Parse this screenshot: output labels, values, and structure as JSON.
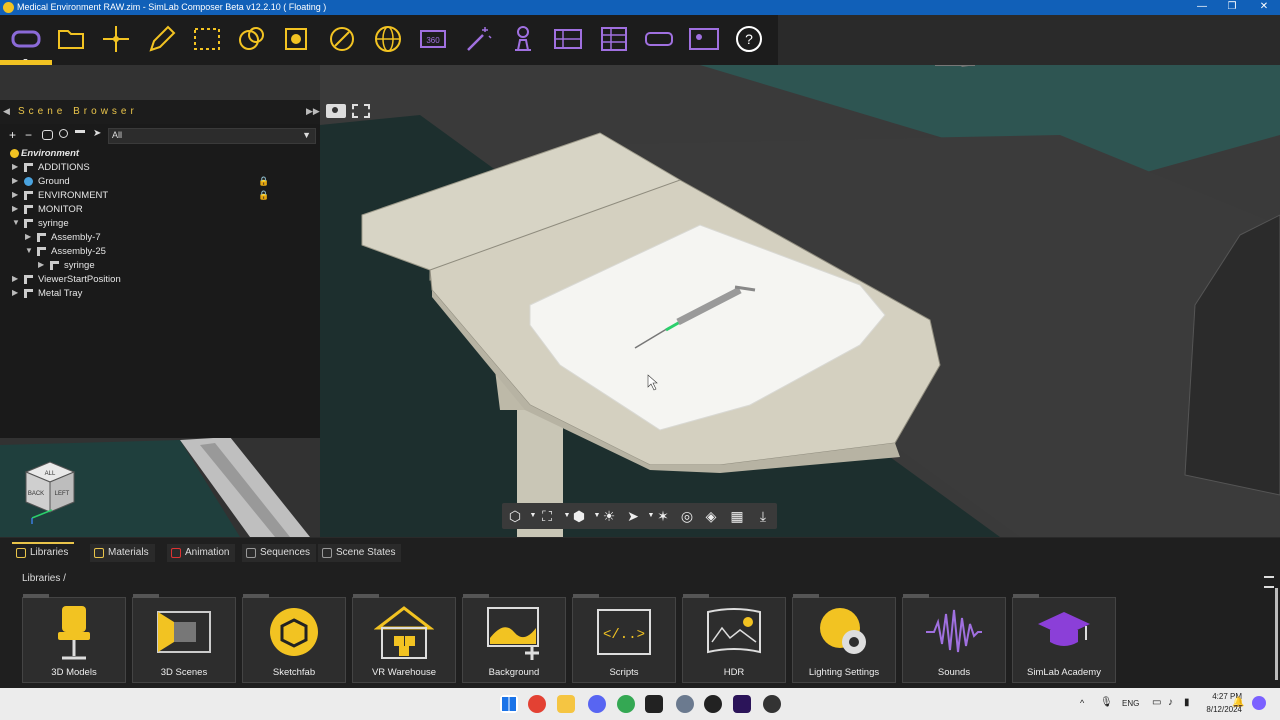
{
  "window": {
    "title": "Medical Environment RAW.zim - SimLab Composer Beta v12.2.10 ( Floating )",
    "controls": [
      "—",
      "❐",
      "✕"
    ]
  },
  "toolbar": {
    "tools": [
      {
        "name": "vr-headset",
        "color": "#8b6ad8"
      },
      {
        "name": "open-folder",
        "color": "#f2c322"
      },
      {
        "name": "move",
        "color": "#f2c322"
      },
      {
        "name": "edit",
        "color": "#f2c322"
      },
      {
        "name": "select-box",
        "color": "#f2c322"
      },
      {
        "name": "materials",
        "color": "#f2c322"
      },
      {
        "name": "render",
        "color": "#f2c322"
      },
      {
        "name": "no-entry",
        "color": "#f2c322"
      },
      {
        "name": "globe",
        "color": "#f2c322"
      },
      {
        "name": "360",
        "color": "#a070e0"
      },
      {
        "name": "magic-wand",
        "color": "#a070e0"
      },
      {
        "name": "presenter",
        "color": "#a070e0"
      },
      {
        "name": "sequence",
        "color": "#a070e0"
      },
      {
        "name": "layout",
        "color": "#a070e0"
      },
      {
        "name": "vr-goggles",
        "color": "#a070e0"
      },
      {
        "name": "user-screen",
        "color": "#a070e0"
      },
      {
        "name": "help",
        "color": "#ffffff"
      }
    ]
  },
  "scene_browser": {
    "title": "Scene Browser",
    "filter": "All",
    "tree": [
      {
        "label": "Environment",
        "level": 0,
        "arrow": "",
        "icon": "sun",
        "bold": true,
        "locked": false
      },
      {
        "label": "ADDITIONS",
        "level": 1,
        "arrow": "▶",
        "icon": "assembly",
        "locked": false
      },
      {
        "label": "Ground",
        "level": 1,
        "arrow": "▶",
        "icon": "sphere",
        "locked": true
      },
      {
        "label": "ENVIRONMENT",
        "level": 1,
        "arrow": "▶",
        "icon": "assembly",
        "locked": true
      },
      {
        "label": "MONITOR",
        "level": 1,
        "arrow": "▶",
        "icon": "assembly",
        "locked": false
      },
      {
        "label": "syringe",
        "level": 1,
        "arrow": "▼",
        "icon": "assembly",
        "locked": false
      },
      {
        "label": "Assembly-7",
        "level": 2,
        "arrow": "▶",
        "icon": "assembly",
        "locked": false
      },
      {
        "label": "Assembly-25",
        "level": 2,
        "arrow": "▼",
        "icon": "assembly",
        "locked": false
      },
      {
        "label": "syringe",
        "level": 3,
        "arrow": "▶",
        "icon": "assembly",
        "locked": false
      },
      {
        "label": "ViewerStartPosition",
        "level": 1,
        "arrow": "▶",
        "icon": "assembly",
        "locked": false
      },
      {
        "label": "Metal Tray",
        "level": 1,
        "arrow": "▶",
        "icon": "assembly",
        "locked": false
      }
    ]
  },
  "viewcube": {
    "top": "ALL",
    "front": "BACK",
    "side": "LEFT"
  },
  "bottom_panel": {
    "tabs": [
      {
        "label": "Libraries",
        "active": true
      },
      {
        "label": "Materials",
        "active": false
      },
      {
        "label": "Animation",
        "active": false
      },
      {
        "label": "Sequences",
        "active": false
      },
      {
        "label": "Scene States",
        "active": false
      }
    ],
    "breadcrumb": "Libraries  /",
    "libraries": [
      {
        "label": "3D Models",
        "icon": "chair-icon"
      },
      {
        "label": "3D Scenes",
        "icon": "scene-icon"
      },
      {
        "label": "Sketchfab",
        "icon": "sketchfab-icon"
      },
      {
        "label": "VR Warehouse",
        "icon": "warehouse-icon"
      },
      {
        "label": "Background",
        "icon": "background-icon"
      },
      {
        "label": "Scripts",
        "icon": "scripts-icon"
      },
      {
        "label": "HDR",
        "icon": "hdr-icon"
      },
      {
        "label": "Lighting Settings",
        "icon": "lighting-icon"
      },
      {
        "label": "Sounds",
        "icon": "sound-wave-icon"
      },
      {
        "label": "SimLab Academy",
        "icon": "academy-icon"
      }
    ]
  },
  "taskbar": {
    "lang": "ENG",
    "time": "4:27 PM",
    "date": "8/12/2024"
  }
}
